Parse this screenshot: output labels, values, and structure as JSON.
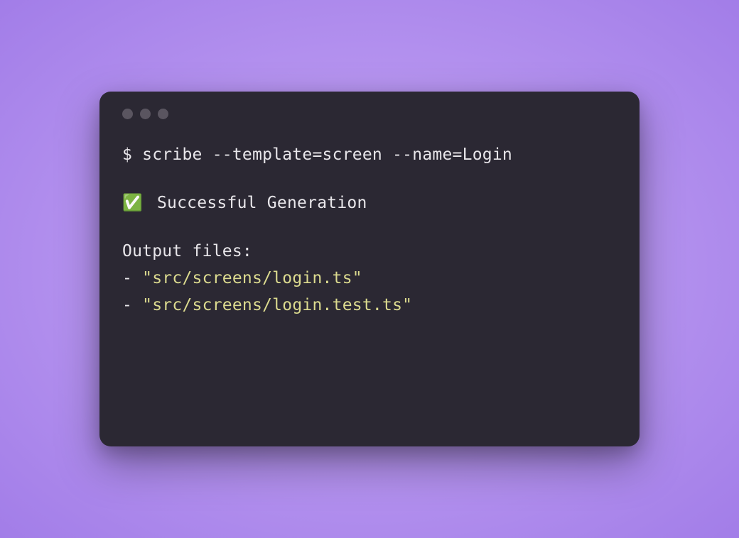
{
  "terminal": {
    "command": "$ scribe --template=screen --name=Login",
    "status": {
      "icon": "✅",
      "text": " Successful Generation"
    },
    "output": {
      "header": "Output files:",
      "files": [
        "\"src/screens/login.ts\"",
        "\"src/screens/login.test.ts\""
      ]
    }
  }
}
